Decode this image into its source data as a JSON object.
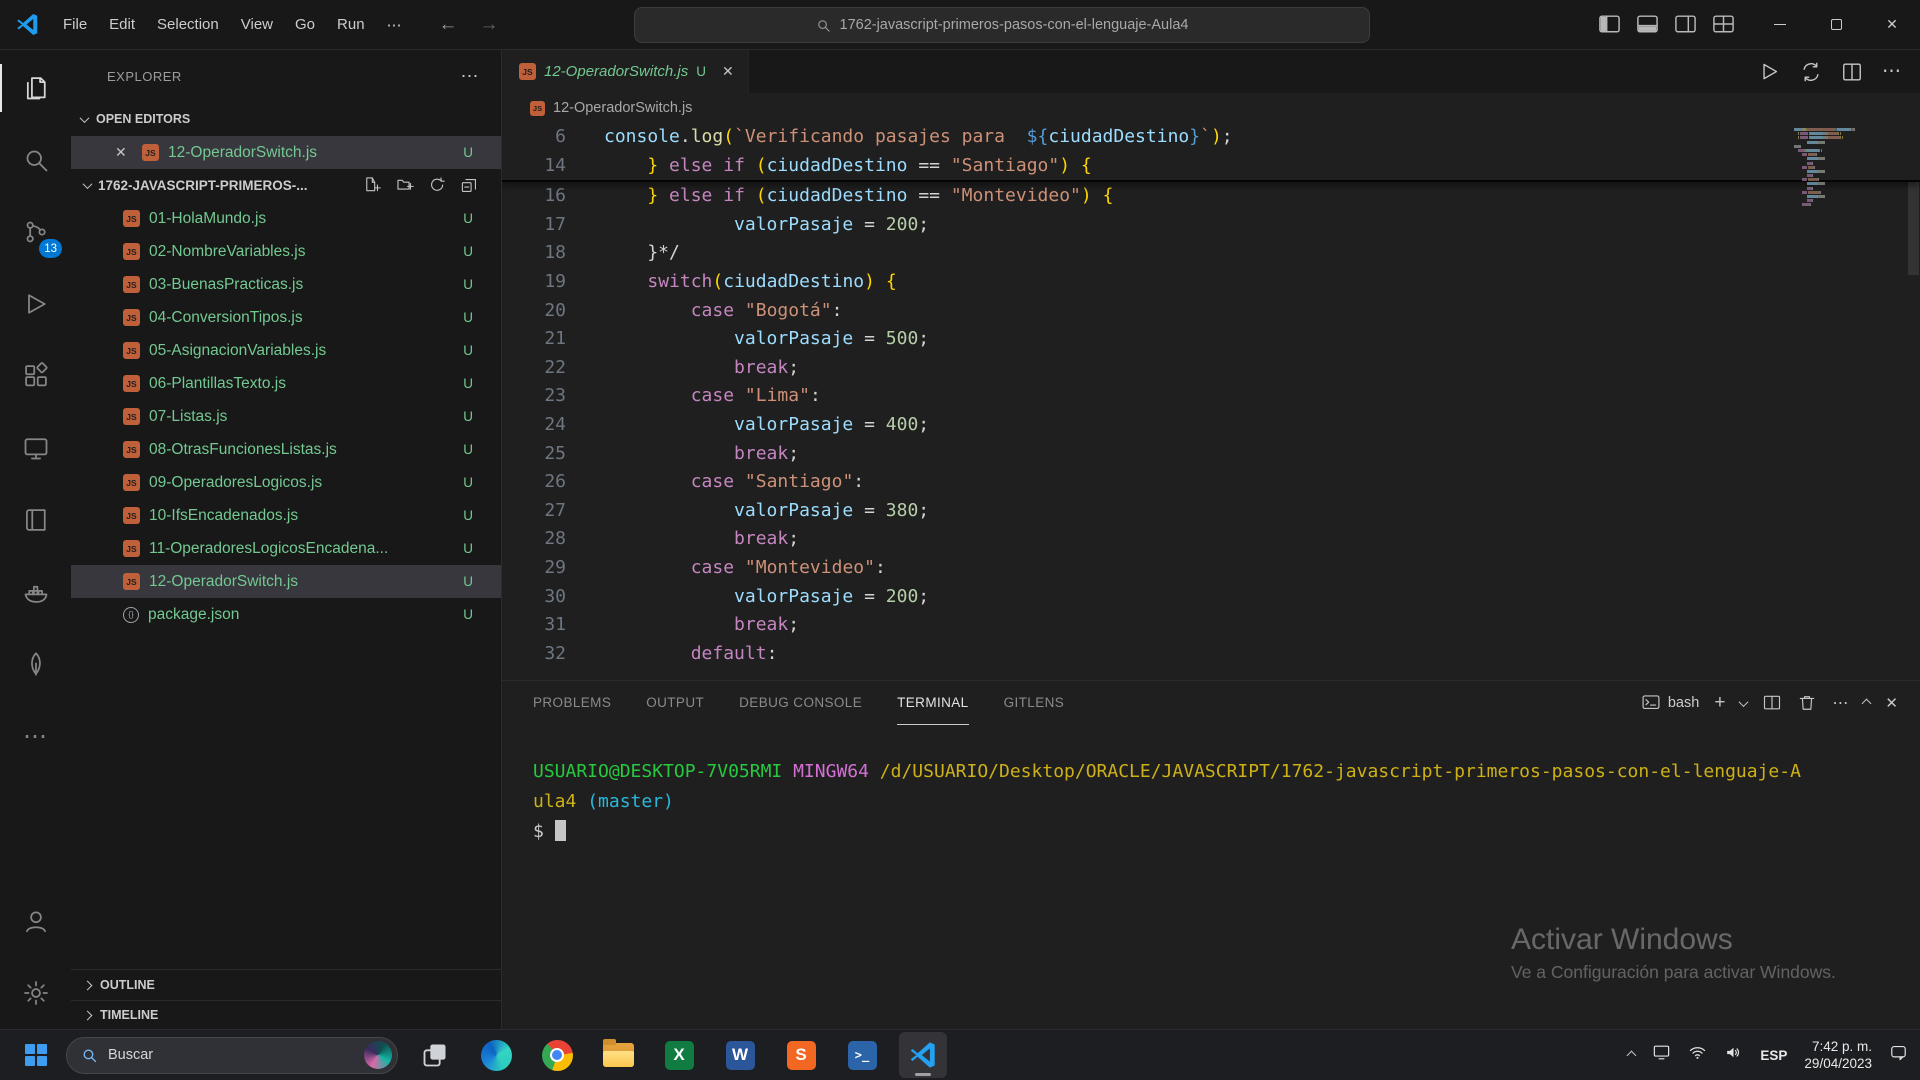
{
  "colors": {
    "accent": "#0078d4",
    "untracked_green": "#73c991",
    "editor_bg": "#1f1f1f",
    "side_bg": "#181818",
    "selection_bg": "#37373d"
  },
  "icons": {
    "ellipsis": "⋯",
    "close": "✕",
    "plus": "+",
    "back": "←",
    "forward": "→",
    "js_label": "JS",
    "json_label": "{}"
  },
  "window": {
    "menus": [
      "File",
      "Edit",
      "Selection",
      "View",
      "Go",
      "Run"
    ],
    "search_title": "1762-javascript-primeros-pasos-con-el-lenguaje-Aula4"
  },
  "activity_bar": {
    "scm_badge": "13"
  },
  "sidebar": {
    "title": "EXPLORER",
    "open_editors_label": "OPEN EDITORS",
    "open_editor": {
      "name": "12-OperadorSwitch.js",
      "badge": "U"
    },
    "folder_label": "1762-JAVASCRIPT-PRIMEROS-...",
    "files": [
      {
        "name": "01-HolaMundo.js",
        "badge": "U",
        "type": "js"
      },
      {
        "name": "02-NombreVariables.js",
        "badge": "U",
        "type": "js"
      },
      {
        "name": "03-BuenasPracticas.js",
        "badge": "U",
        "type": "js"
      },
      {
        "name": "04-ConversionTipos.js",
        "badge": "U",
        "type": "js"
      },
      {
        "name": "05-AsignacionVariables.js",
        "badge": "U",
        "type": "js"
      },
      {
        "name": "06-PlantillasTexto.js",
        "badge": "U",
        "type": "js"
      },
      {
        "name": "07-Listas.js",
        "badge": "U",
        "type": "js"
      },
      {
        "name": "08-OtrasFuncionesListas.js",
        "badge": "U",
        "type": "js"
      },
      {
        "name": "09-OperadoresLogicos.js",
        "badge": "U",
        "type": "js"
      },
      {
        "name": "10-IfsEncadenados.js",
        "badge": "U",
        "type": "js"
      },
      {
        "name": "11-OperadoresLogicosEncadena...",
        "badge": "U",
        "type": "js"
      },
      {
        "name": "12-OperadorSwitch.js",
        "badge": "U",
        "type": "js",
        "selected": true
      },
      {
        "name": "package.json",
        "badge": "U",
        "type": "json"
      }
    ],
    "outline_label": "OUTLINE",
    "timeline_label": "TIMELINE"
  },
  "editor": {
    "tab": {
      "name": "12-OperadorSwitch.js",
      "badge": "U"
    },
    "breadcrumb": "12-OperadorSwitch.js",
    "sticky_lines": [
      {
        "n": "6",
        "segs": [
          [
            "console",
            "var"
          ],
          [
            ".",
            "pl"
          ],
          [
            "log",
            "fn"
          ],
          [
            "(",
            "br"
          ],
          [
            "`Verificando pasajes para  ",
            "str"
          ],
          [
            "${",
            "tpl"
          ],
          [
            "ciudadDestino",
            "var"
          ],
          [
            "}",
            "tpl"
          ],
          [
            "`",
            "str"
          ],
          [
            ")",
            "br"
          ],
          [
            ";",
            "pl"
          ]
        ]
      },
      {
        "n": "14",
        "segs": [
          [
            "    ",
            "pl"
          ],
          [
            "}",
            "br"
          ],
          [
            " ",
            "pl"
          ],
          [
            "else if",
            "kw"
          ],
          [
            " ",
            "pl"
          ],
          [
            "(",
            "br"
          ],
          [
            "ciudadDestino",
            "var"
          ],
          [
            " == ",
            "pl"
          ],
          [
            "\"Santiago\"",
            "str"
          ],
          [
            ")",
            "br"
          ],
          [
            " ",
            "pl"
          ],
          [
            "{",
            "br"
          ]
        ]
      }
    ],
    "lines": [
      {
        "n": "16",
        "segs": [
          [
            "    ",
            "pl"
          ],
          [
            "}",
            "br"
          ],
          [
            " ",
            "pl"
          ],
          [
            "else if",
            "kw"
          ],
          [
            " ",
            "pl"
          ],
          [
            "(",
            "br"
          ],
          [
            "ciudadDestino",
            "var"
          ],
          [
            " == ",
            "pl"
          ],
          [
            "\"Montevideo\"",
            "str"
          ],
          [
            ")",
            "br"
          ],
          [
            " ",
            "pl"
          ],
          [
            "{",
            "br"
          ]
        ]
      },
      {
        "n": "17",
        "segs": [
          [
            "            ",
            "pl"
          ],
          [
            "valorPasaje",
            "var"
          ],
          [
            " = ",
            "pl"
          ],
          [
            "200",
            "num"
          ],
          [
            ";",
            "pl"
          ]
        ]
      },
      {
        "n": "18",
        "segs": [
          [
            "    }*/",
            "pl"
          ]
        ]
      },
      {
        "n": "19",
        "segs": [
          [
            "    ",
            "pl"
          ],
          [
            "switch",
            "kw"
          ],
          [
            "(",
            "br"
          ],
          [
            "ciudadDestino",
            "var"
          ],
          [
            ")",
            "br"
          ],
          [
            " ",
            "pl"
          ],
          [
            "{",
            "br"
          ]
        ]
      },
      {
        "n": "20",
        "segs": [
          [
            "        ",
            "pl"
          ],
          [
            "case",
            "kw"
          ],
          [
            " ",
            "pl"
          ],
          [
            "\"Bogotá\"",
            "str"
          ],
          [
            ":",
            "pl"
          ]
        ]
      },
      {
        "n": "21",
        "segs": [
          [
            "            ",
            "pl"
          ],
          [
            "valorPasaje",
            "var"
          ],
          [
            " = ",
            "pl"
          ],
          [
            "500",
            "num"
          ],
          [
            ";",
            "pl"
          ]
        ]
      },
      {
        "n": "22",
        "segs": [
          [
            "            ",
            "pl"
          ],
          [
            "break",
            "kw"
          ],
          [
            ";",
            "pl"
          ]
        ]
      },
      {
        "n": "23",
        "segs": [
          [
            "        ",
            "pl"
          ],
          [
            "case",
            "kw"
          ],
          [
            " ",
            "pl"
          ],
          [
            "\"Lima\"",
            "str"
          ],
          [
            ":",
            "pl"
          ]
        ]
      },
      {
        "n": "24",
        "segs": [
          [
            "            ",
            "pl"
          ],
          [
            "valorPasaje",
            "var"
          ],
          [
            " = ",
            "pl"
          ],
          [
            "400",
            "num"
          ],
          [
            ";",
            "pl"
          ]
        ]
      },
      {
        "n": "25",
        "segs": [
          [
            "            ",
            "pl"
          ],
          [
            "break",
            "kw"
          ],
          [
            ";",
            "pl"
          ]
        ]
      },
      {
        "n": "26",
        "segs": [
          [
            "        ",
            "pl"
          ],
          [
            "case",
            "kw"
          ],
          [
            " ",
            "pl"
          ],
          [
            "\"Santiago\"",
            "str"
          ],
          [
            ":",
            "pl"
          ]
        ]
      },
      {
        "n": "27",
        "segs": [
          [
            "            ",
            "pl"
          ],
          [
            "valorPasaje",
            "var"
          ],
          [
            " = ",
            "pl"
          ],
          [
            "380",
            "num"
          ],
          [
            ";",
            "pl"
          ]
        ]
      },
      {
        "n": "28",
        "segs": [
          [
            "            ",
            "pl"
          ],
          [
            "break",
            "kw"
          ],
          [
            ";",
            "pl"
          ]
        ]
      },
      {
        "n": "29",
        "segs": [
          [
            "        ",
            "pl"
          ],
          [
            "case",
            "kw"
          ],
          [
            " ",
            "pl"
          ],
          [
            "\"Montevideo\"",
            "str"
          ],
          [
            ":",
            "pl"
          ]
        ]
      },
      {
        "n": "30",
        "segs": [
          [
            "            ",
            "pl"
          ],
          [
            "valorPasaje",
            "var"
          ],
          [
            " = ",
            "pl"
          ],
          [
            "200",
            "num"
          ],
          [
            ";",
            "pl"
          ]
        ]
      },
      {
        "n": "31",
        "segs": [
          [
            "            ",
            "pl"
          ],
          [
            "break",
            "kw"
          ],
          [
            ";",
            "pl"
          ]
        ]
      },
      {
        "n": "32",
        "segs": [
          [
            "        ",
            "pl"
          ],
          [
            "default",
            "kw"
          ],
          [
            ":",
            "pl"
          ]
        ]
      }
    ]
  },
  "panel": {
    "tabs": [
      {
        "label": "PROBLEMS"
      },
      {
        "label": "OUTPUT"
      },
      {
        "label": "DEBUG CONSOLE"
      },
      {
        "label": "TERMINAL",
        "active": true
      },
      {
        "label": "GITLENS"
      }
    ],
    "shell_label": "bash",
    "terminal_lines": [
      {
        "segs": [
          [
            "USUARIO@DESKTOP-7V05RMI",
            "g"
          ],
          [
            " ",
            "w"
          ],
          [
            "MINGW64",
            "m"
          ],
          [
            " ",
            "w"
          ],
          [
            "/d/USUARIO/Desktop/ORACLE/JAVASCRIPT/1762-javascript-primeros-pasos-con-el-lenguaje-A",
            "y"
          ]
        ]
      },
      {
        "segs": [
          [
            "ula4",
            "y"
          ],
          [
            " ",
            "w"
          ],
          [
            "(master)",
            "c"
          ]
        ]
      },
      {
        "segs": [
          [
            "$ ",
            "w"
          ]
        ],
        "cursor": true
      }
    ]
  },
  "watermark": {
    "title": "Activar Windows",
    "subtitle": "Ve a Configuración para activar Windows."
  },
  "taskbar": {
    "search_placeholder": "Buscar",
    "tray": {
      "lang": "ESP",
      "time": "7:42 p. m.",
      "date": "29/04/2023"
    }
  }
}
